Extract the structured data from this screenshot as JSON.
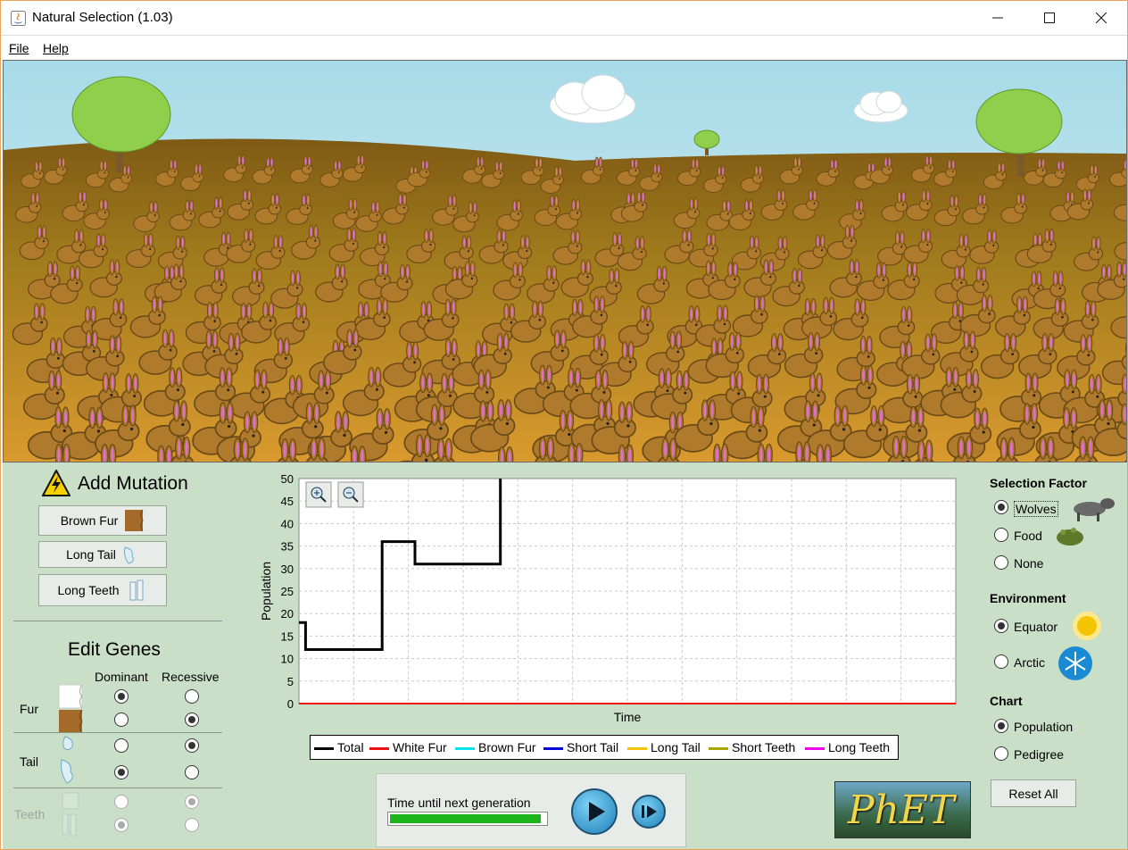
{
  "window": {
    "title": "Natural Selection (1.03)"
  },
  "menu": {
    "file": "File",
    "help": "Help"
  },
  "mutation": {
    "title": "Add Mutation",
    "brown_fur": "Brown Fur",
    "long_tail": "Long Tail",
    "long_teeth": "Long Teeth"
  },
  "genes": {
    "title": "Edit Genes",
    "dominant": "Dominant",
    "recessive": "Recessive",
    "fur": "Fur",
    "tail": "Tail",
    "teeth": "Teeth"
  },
  "chart_data": {
    "type": "line",
    "ylabel": "Population",
    "xlabel": "Time",
    "ylim": [
      0,
      50
    ],
    "yticks": [
      "50",
      "45",
      "40",
      "35",
      "30",
      "25",
      "20",
      "15",
      "10",
      "5",
      "0"
    ],
    "grid": true,
    "series": [
      {
        "name": "Total",
        "color": "#000000",
        "points": [
          [
            0,
            18
          ],
          [
            0.03,
            18
          ],
          [
            0.03,
            12
          ],
          [
            0.38,
            12
          ],
          [
            0.38,
            36
          ],
          [
            0.53,
            36
          ],
          [
            0.53,
            31
          ],
          [
            0.92,
            31
          ],
          [
            0.92,
            50
          ]
        ]
      },
      {
        "name": "White Fur",
        "color": "#ee1111",
        "points": [
          [
            0,
            0
          ],
          [
            3.0,
            0
          ]
        ]
      },
      {
        "name": "Brown Fur",
        "color": "#00e5ee",
        "points": []
      },
      {
        "name": "Short Tail",
        "color": "#0000dd",
        "points": []
      },
      {
        "name": "Long Tail",
        "color": "#f5c400",
        "points": []
      },
      {
        "name": "Short Teeth",
        "color": "#a6a600",
        "points": []
      },
      {
        "name": "Long Teeth",
        "color": "#ee00ee",
        "points": []
      }
    ],
    "xmax": 3.0
  },
  "legend": [
    "Total",
    "White Fur",
    "Brown Fur",
    "Short Tail",
    "Long Tail",
    "Short Teeth",
    "Long Teeth"
  ],
  "generation": {
    "label": "Time until next generation",
    "progress": 0.97
  },
  "selection": {
    "title": "Selection Factor",
    "options": [
      "Wolves",
      "Food",
      "None"
    ],
    "selected": "Wolves"
  },
  "environment": {
    "title": "Environment",
    "options": [
      "Equator",
      "Arctic"
    ],
    "selected": "Equator"
  },
  "chart": {
    "title": "Chart",
    "options": [
      "Population",
      "Pedigree"
    ],
    "selected": "Population"
  },
  "reset": "Reset All",
  "logo": "PhET",
  "colors": {
    "panel": "#c9dfc8",
    "sky": "#a7dbe8",
    "ground": "#c8912c",
    "progress": "#1db41d"
  }
}
